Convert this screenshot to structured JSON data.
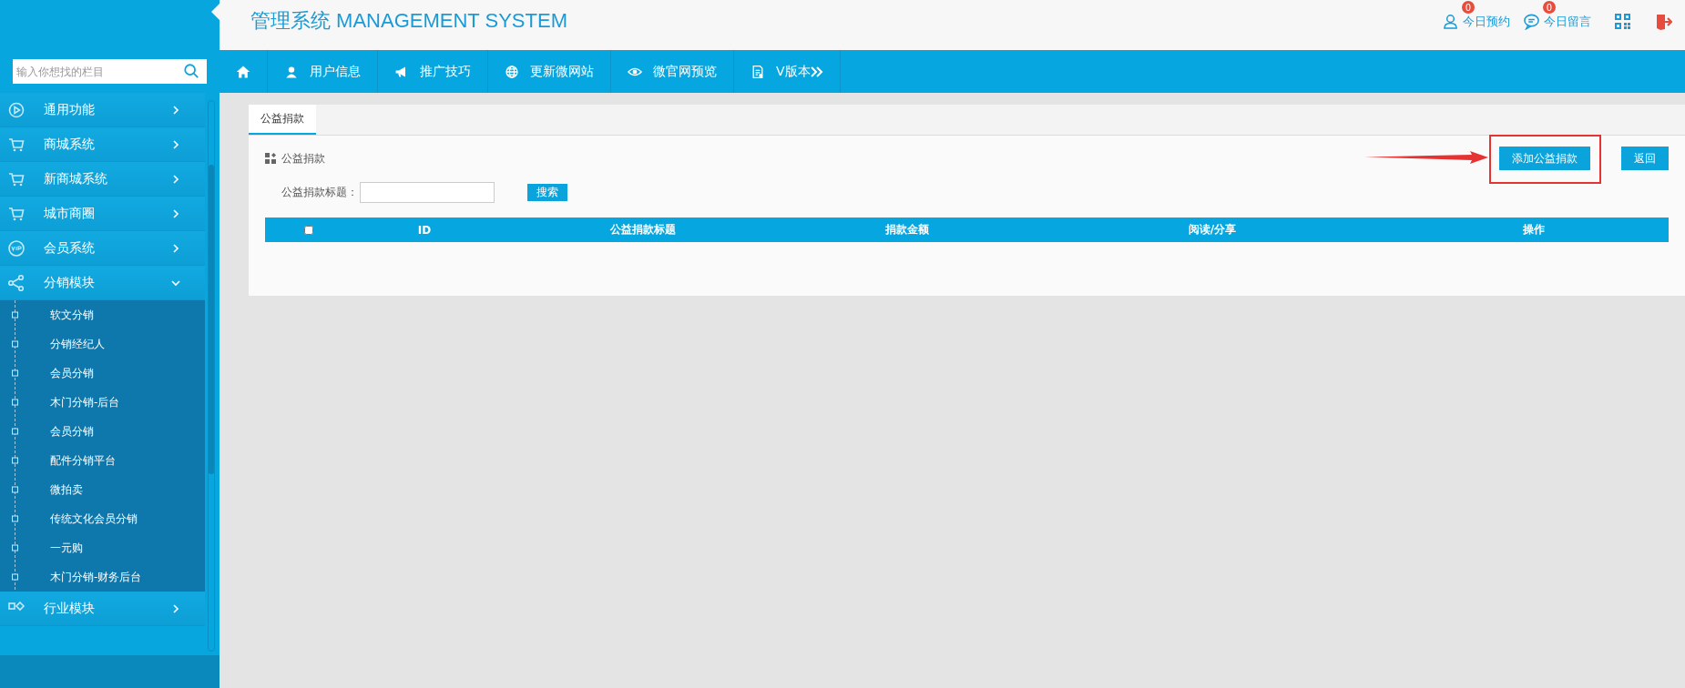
{
  "header": {
    "title": "管理系统 MANAGEMENT SYSTEM",
    "links": [
      {
        "kind": "user",
        "label": "今日预约",
        "badge": "0"
      },
      {
        "kind": "chat",
        "label": "今日留言",
        "badge": "0"
      }
    ]
  },
  "sidebar": {
    "search": {
      "placeholder": "输入你想找的栏目"
    },
    "menu": [
      {
        "kind": "play",
        "label": "通用功能",
        "expanded": false
      },
      {
        "kind": "cart",
        "label": "商城系统",
        "expanded": false
      },
      {
        "kind": "cart",
        "label": "新商城系统",
        "expanded": false
      },
      {
        "kind": "cart",
        "label": "城市商圈",
        "expanded": false
      },
      {
        "kind": "vip",
        "label": "会员系统",
        "expanded": false
      },
      {
        "kind": "share",
        "label": "分销模块",
        "expanded": true,
        "children": [
          {
            "label": "软文分销"
          },
          {
            "label": "分销经纪人"
          },
          {
            "label": "会员分销"
          },
          {
            "label": "木门分销-后台"
          },
          {
            "label": "会员分销"
          },
          {
            "label": "配件分销平台"
          },
          {
            "label": "微拍卖"
          },
          {
            "label": "传统文化会员分销"
          },
          {
            "label": "一元购"
          },
          {
            "label": "木门分销-财务后台"
          }
        ]
      },
      {
        "kind": "module",
        "label": "行业模块",
        "expanded": false
      }
    ]
  },
  "nav": [
    {
      "kind": "home"
    },
    {
      "kind": "user",
      "label": "用户信息"
    },
    {
      "kind": "megaphone",
      "label": "推广技巧"
    },
    {
      "kind": "globe",
      "label": "更新微网站"
    },
    {
      "kind": "eye",
      "label": "微官网预览"
    },
    {
      "kind": "doc",
      "label": "V版本",
      "more": true
    }
  ],
  "tabs": [
    {
      "label": "公益捐款",
      "selected": true
    }
  ],
  "panel": {
    "title": "公益捐款",
    "buttons": [
      {
        "label": "添加公益捐款",
        "highlighted": true
      },
      {
        "label": "返回",
        "highlighted": false
      }
    ],
    "filter": {
      "label": "公益捐款标题：",
      "button": "搜索"
    },
    "table": {
      "select_all": {
        "checked": false
      },
      "columns": [
        "ID",
        "公益捐款标题",
        "捐款金额",
        "阅读/分享",
        "操作"
      ]
    }
  }
}
